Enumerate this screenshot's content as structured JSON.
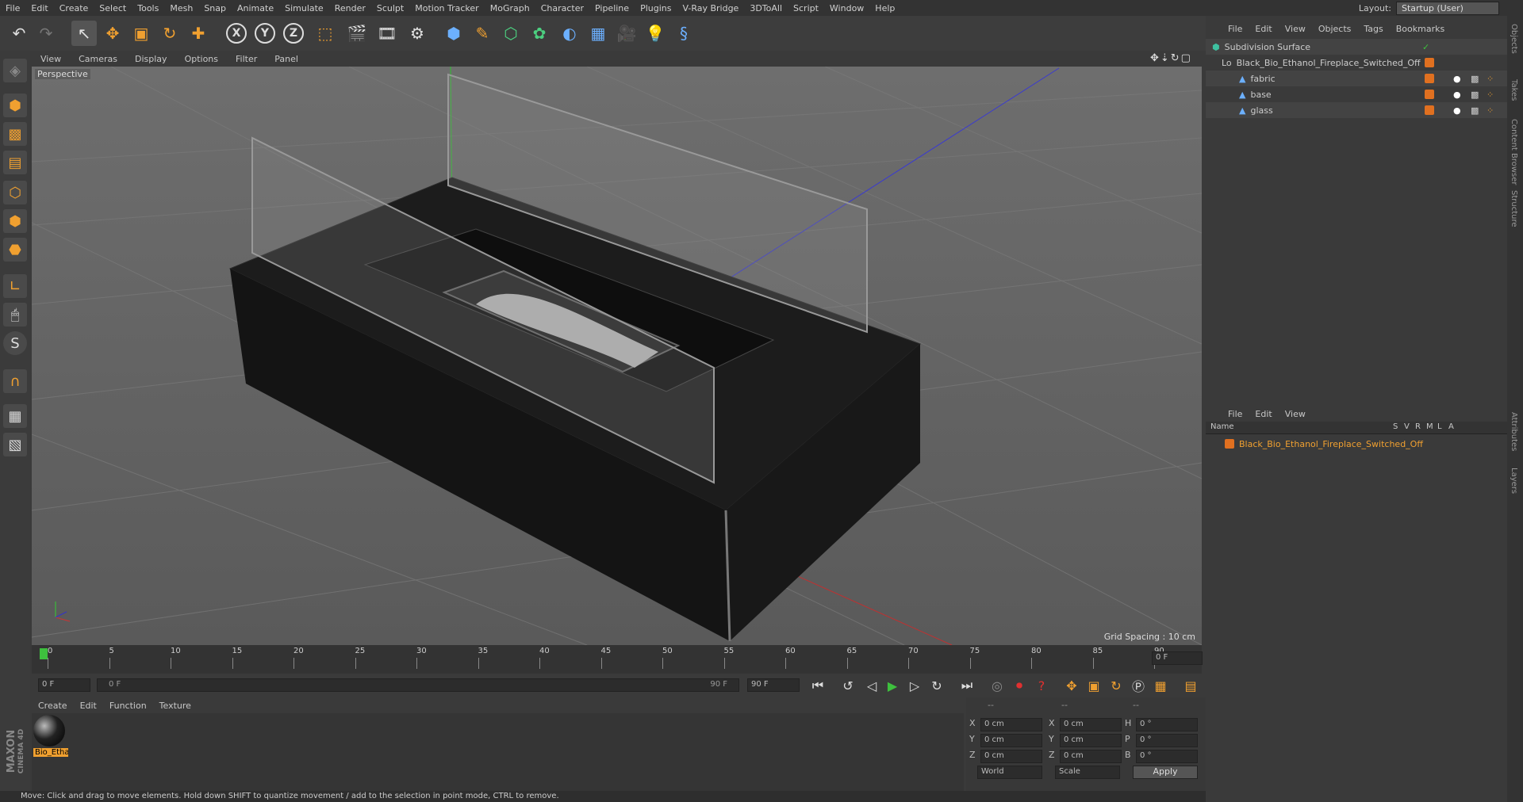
{
  "menu": [
    "File",
    "Edit",
    "Create",
    "Select",
    "Tools",
    "Mesh",
    "Snap",
    "Animate",
    "Simulate",
    "Render",
    "Sculpt",
    "Motion Tracker",
    "MoGraph",
    "Character",
    "Pipeline",
    "Plugins",
    "V-Ray Bridge",
    "3DToAll",
    "Script",
    "Window",
    "Help"
  ],
  "layout": {
    "label": "Layout:",
    "value": "Startup (User)"
  },
  "viewport": {
    "menu": [
      "View",
      "Cameras",
      "Display",
      "Options",
      "Filter",
      "Panel"
    ],
    "label": "Perspective",
    "grid_spacing": "Grid Spacing : 10 cm"
  },
  "timeline": {
    "ticks": [
      "0",
      "5",
      "10",
      "15",
      "20",
      "25",
      "30",
      "35",
      "40",
      "45",
      "50",
      "55",
      "60",
      "65",
      "70",
      "75",
      "80",
      "85",
      "90"
    ],
    "current_frame": "0 F",
    "start_field": "0 F",
    "range_start": "0 F",
    "range_end": "90 F",
    "end_field": "90 F"
  },
  "material_manager": {
    "menu": [
      "Create",
      "Edit",
      "Function",
      "Texture"
    ],
    "materials": [
      {
        "name": "Bio_Etha"
      }
    ]
  },
  "coordinates": {
    "header": [
      "--",
      "--",
      "--"
    ],
    "rows": [
      {
        "axis": "X",
        "pos": "0 cm",
        "axis2": "X",
        "size": "0 cm",
        "rot_axis": "H",
        "rot": "0 °"
      },
      {
        "axis": "Y",
        "pos": "0 cm",
        "axis2": "Y",
        "size": "0 cm",
        "rot_axis": "P",
        "rot": "0 °"
      },
      {
        "axis": "Z",
        "pos": "0 cm",
        "axis2": "Z",
        "size": "0 cm",
        "rot_axis": "B",
        "rot": "0 °"
      }
    ],
    "mode1": "World",
    "mode2": "Scale",
    "apply": "Apply"
  },
  "status": "Move: Click and drag to move elements. Hold down SHIFT to quantize movement / add to the selection in point mode, CTRL to remove.",
  "objects": {
    "menu": [
      "File",
      "Edit",
      "View",
      "Objects",
      "Tags",
      "Bookmarks"
    ],
    "tree": [
      {
        "name": "Subdivision Surface",
        "depth": 0
      },
      {
        "name": "Black_Bio_Ethanol_Fireplace_Switched_Off",
        "depth": 1
      },
      {
        "name": "fabric",
        "depth": 2
      },
      {
        "name": "base",
        "depth": 2
      },
      {
        "name": "glass",
        "depth": 2
      }
    ]
  },
  "layers": {
    "menu": [
      "File",
      "Edit",
      "View"
    ],
    "columns": [
      "Name",
      "S",
      "V",
      "R",
      "M",
      "L",
      "A"
    ],
    "rows": [
      {
        "name": "Black_Bio_Ethanol_Fireplace_Switched_Off",
        "color": "#e07020"
      }
    ]
  },
  "right_tabs": [
    "Objects",
    "Takes",
    "Content Browser",
    "Structure",
    "Attributes",
    "Layers"
  ],
  "brand": {
    "line1": "MAXON",
    "line2": "CINEMA 4D"
  }
}
